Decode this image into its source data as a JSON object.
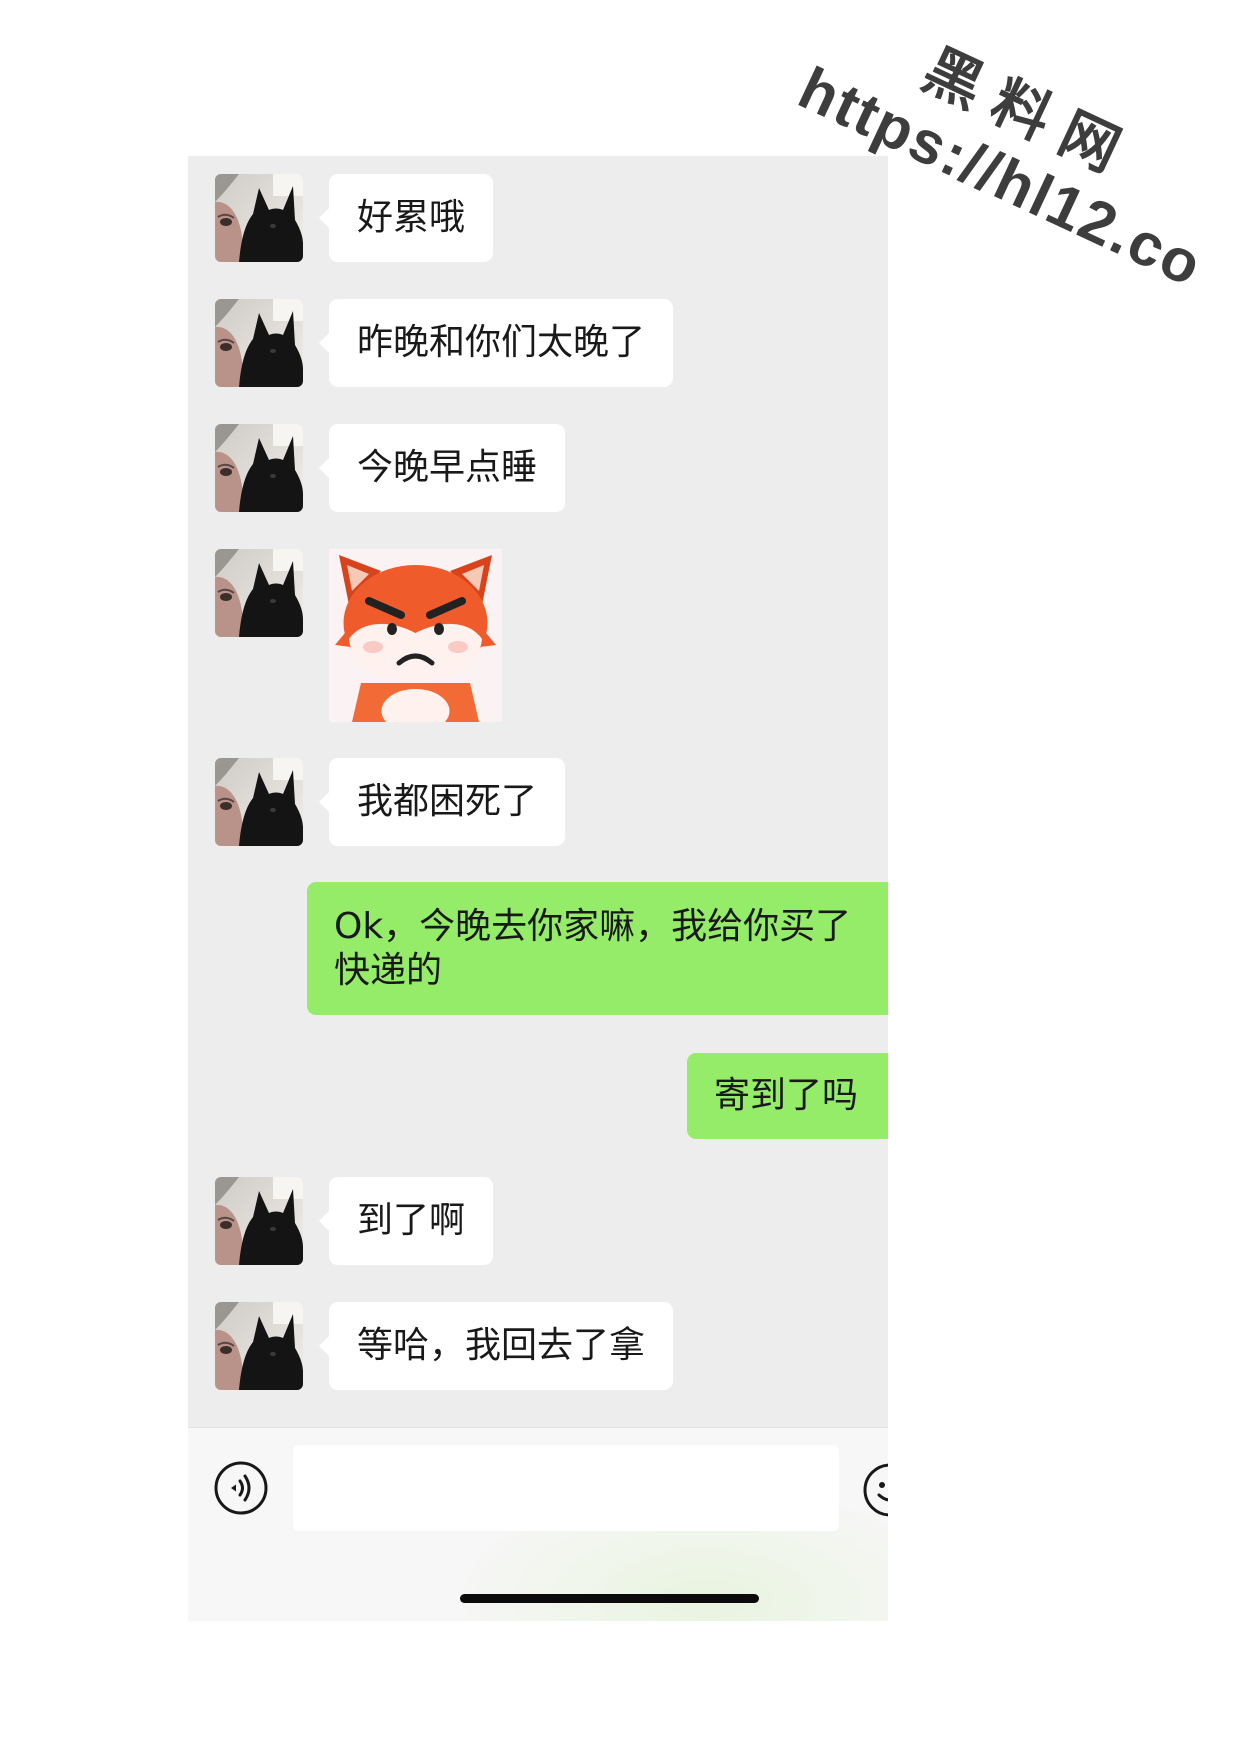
{
  "watermark": {
    "site_name": "黑料网",
    "url": "https://hl12.co"
  },
  "chat": {
    "messages": [
      {
        "outgoing": false,
        "text": "好累哦"
      },
      {
        "outgoing": false,
        "text": "昨晚和你们太晚了"
      },
      {
        "outgoing": false,
        "text": "今晚早点睡"
      },
      {
        "outgoing": false,
        "sticker": "angry-fox-sticker"
      },
      {
        "outgoing": false,
        "text": "我都困死了"
      },
      {
        "outgoing": true,
        "text": "Ok，今晚去你家嘛，我给你买了快递的"
      },
      {
        "outgoing": true,
        "text": "寄到了吗"
      },
      {
        "outgoing": false,
        "text": "到了啊"
      },
      {
        "outgoing": false,
        "text": "等哈，我回去了拿"
      }
    ]
  },
  "input_bar": {
    "voice_icon": "voice-icon",
    "message_input_value": "",
    "emoji_icon": "emoji-icon"
  },
  "colors": {
    "chat_background": "#ededed",
    "incoming_bubble": "#ffffff",
    "outgoing_bubble": "#95ec69",
    "input_bar_background": "#f7f7f7",
    "text": "#191919"
  }
}
